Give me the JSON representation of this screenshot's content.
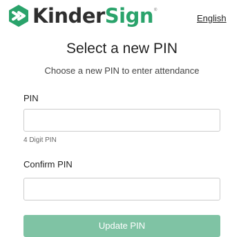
{
  "brand": {
    "name_part1": "Kinder",
    "name_part2": "Sign",
    "registered_mark": "®",
    "colors": {
      "dark": "#2e2e2e",
      "accent": "#2aa36b"
    }
  },
  "language_link": "English",
  "title": "Select a new PIN",
  "subtitle": "Choose a new PIN to enter attendance",
  "form": {
    "pin": {
      "label": "PIN",
      "value": "",
      "hint": "4 Digit PIN"
    },
    "confirm_pin": {
      "label": "Confirm PIN",
      "value": ""
    },
    "submit_label": "Update PIN",
    "submit_color": "#7fc3a4"
  }
}
